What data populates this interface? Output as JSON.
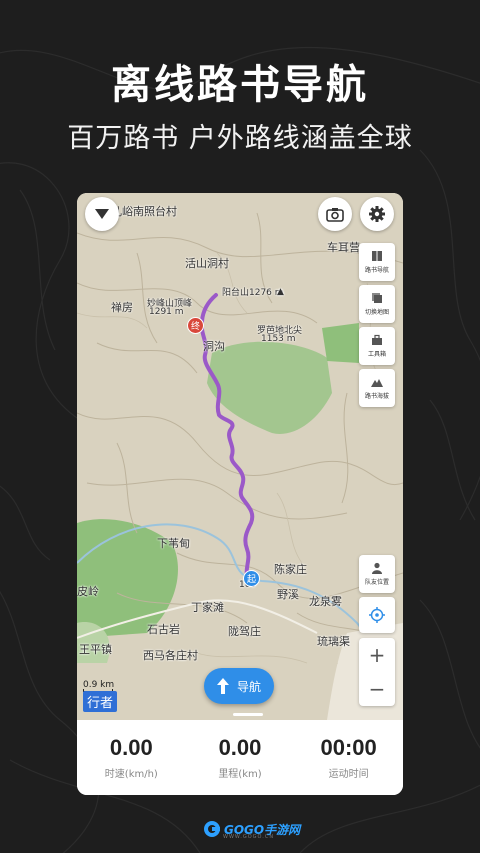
{
  "promo": {
    "headline": "离线路书导航",
    "subline": "百万路书  户外路线涵盖全球"
  },
  "map": {
    "labels": {
      "village_top": "儿峪南照台村",
      "huoshan": "活山洞村",
      "chanfang": "禅房",
      "miaofeng": "妙峰山顶峰",
      "miaofeng_elev": "1291 m",
      "yangtai": "阳台山1276 m",
      "dongkou": "洞沟",
      "luoba": "罗芭地北尖",
      "luoba_elev": "1153 m",
      "cheer": "车耳营",
      "xiawei": "下苇甸",
      "chenjia": "陈家庄",
      "yexi": "野溪",
      "longquan": "龙泉雾",
      "dingjia": "丁家滩",
      "shigu": "石古岩",
      "longjia": "陇驾庄",
      "liuli": "琉璃渠",
      "xima": "西马各庄村",
      "wangping": "王平镇",
      "ling": "皮岭",
      "start_elev": "109"
    },
    "start_marker": "起",
    "end_marker": "终",
    "scale_text": "0.9 km",
    "mode_badge": "行者",
    "route_color": "#9b59c8"
  },
  "controls": {
    "collapse_icon": "triangle-down-icon",
    "camera_icon": "camera-icon",
    "settings_icon": "gear-icon",
    "side_buttons": [
      {
        "label": "路书导航",
        "icon": "book-icon"
      },
      {
        "label": "切换地图",
        "icon": "layers-icon"
      },
      {
        "label": "工具箱",
        "icon": "toolbox-icon"
      },
      {
        "label": "路书海拔",
        "icon": "mountain-icon"
      }
    ],
    "team_button": {
      "label": "队友位置",
      "icon": "person-icon"
    },
    "locate_icon": "crosshair-icon",
    "zoom_in": "+",
    "zoom_out": "−",
    "navigate_label": "导航"
  },
  "stats": [
    {
      "value": "0.00",
      "caption": "时速(km/h)"
    },
    {
      "value": "0.00",
      "caption": "里程(km)"
    },
    {
      "value": "00:00",
      "caption": "运动时间"
    }
  ],
  "brand": {
    "logo_text": "GOGO手游网",
    "logo_sub": "WWW.GOGO.CN"
  }
}
